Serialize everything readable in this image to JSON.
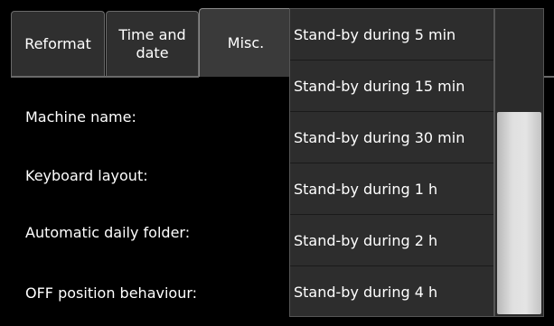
{
  "tabs": [
    {
      "label": "Reformat",
      "active": false
    },
    {
      "label": "Time and\ndate",
      "active": false
    },
    {
      "label": "Misc.",
      "active": true
    }
  ],
  "settings": [
    {
      "label": "Machine name:"
    },
    {
      "label": "Keyboard layout:"
    },
    {
      "label": "Automatic daily folder:"
    },
    {
      "label": "OFF position behaviour:"
    }
  ],
  "dropdown": {
    "options": [
      "Stand-by during 5 min",
      "Stand-by during 15 min",
      "Stand-by during 30 min",
      "Stand-by during 1 h",
      "Stand-by during 2 h",
      "Stand-by during 4 h"
    ],
    "scroll_position": 0.4
  },
  "colors": {
    "background": "#000000",
    "tab_background": "#2f2f2f",
    "dropdown_background": "#2d2d2d",
    "scroll_thumb": "#d8d8d8"
  }
}
